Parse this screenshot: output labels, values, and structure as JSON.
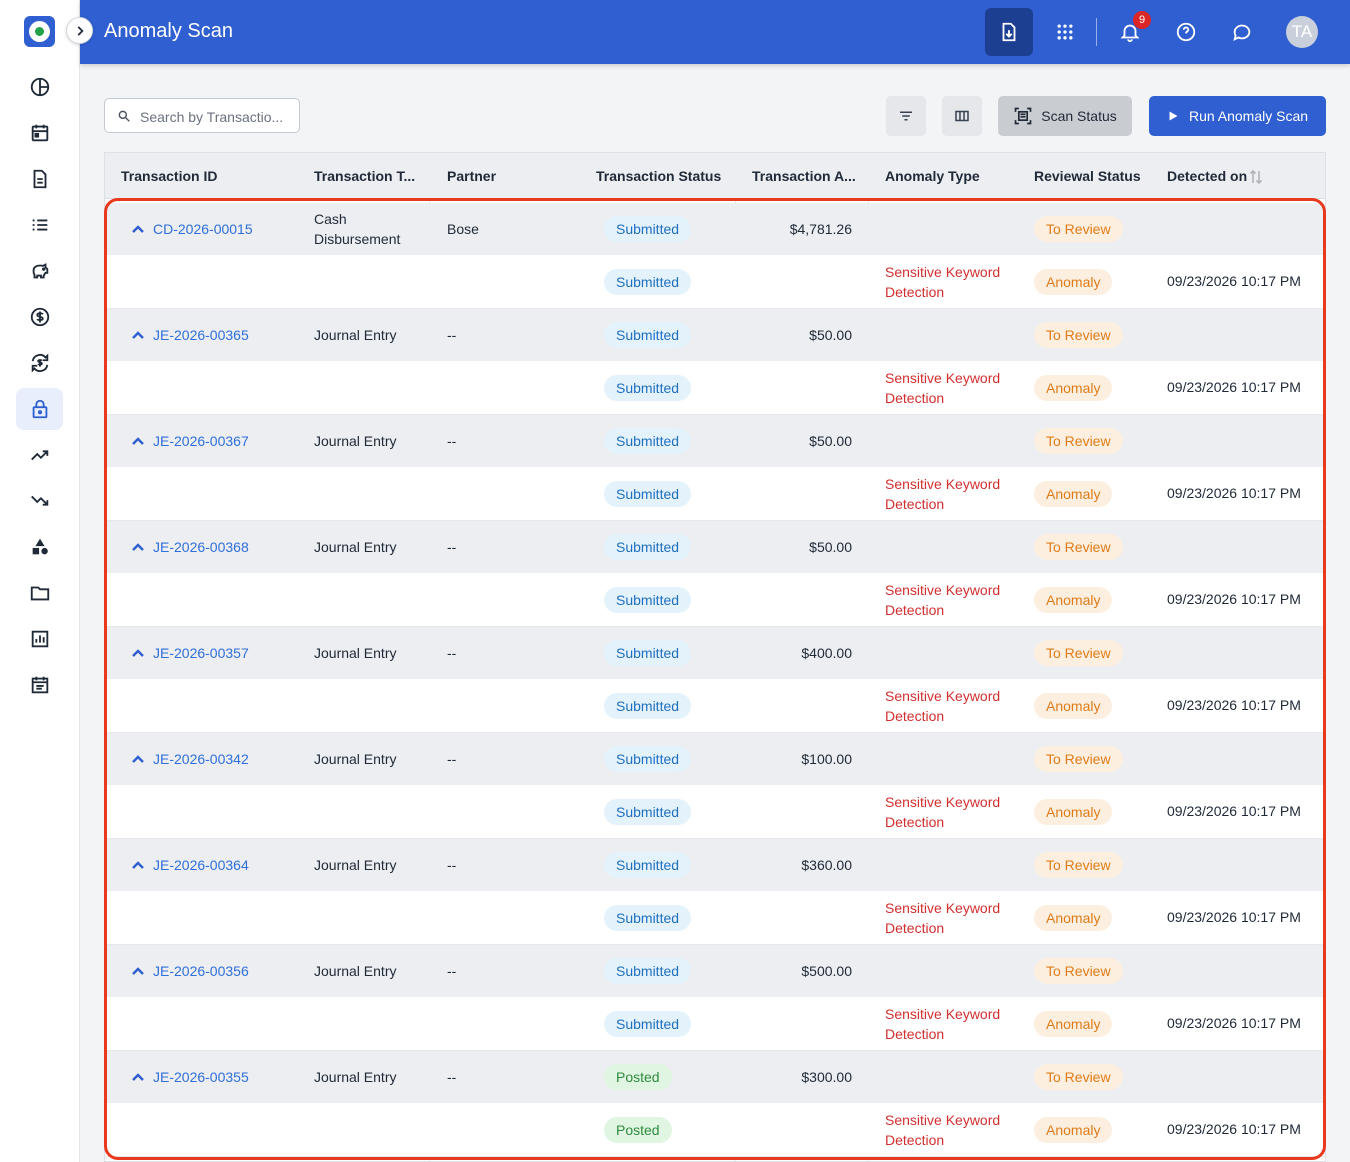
{
  "app": {
    "title": "Anomaly Scan"
  },
  "header": {
    "notification_count": "9",
    "avatar_initials": "TA"
  },
  "sidebar": {
    "items": [
      {
        "icon": "pie-chart-icon"
      },
      {
        "icon": "calendar-icon"
      },
      {
        "icon": "document-icon"
      },
      {
        "icon": "list-icon"
      },
      {
        "icon": "piggy-bank-icon"
      },
      {
        "icon": "dollar-circle-icon"
      },
      {
        "icon": "currency-exchange-icon"
      },
      {
        "icon": "lock-icon",
        "active": true
      },
      {
        "icon": "trending-up-icon"
      },
      {
        "icon": "trending-down-icon"
      },
      {
        "icon": "shapes-icon"
      },
      {
        "icon": "folder-icon"
      },
      {
        "icon": "bar-chart-icon"
      },
      {
        "icon": "event-note-icon"
      }
    ]
  },
  "toolbar": {
    "search_placeholder": "Search by Transactio...",
    "scan_status_label": "Scan Status",
    "run_label": "Run Anomaly Scan"
  },
  "table": {
    "headers": {
      "id": "Transaction ID",
      "type": "Transaction T...",
      "partner": "Partner",
      "status": "Transaction Status",
      "amount": "Transaction A...",
      "anomaly": "Anomaly Type",
      "review": "Reviewal Status",
      "detected": "Detected on"
    },
    "rows": [
      {
        "id": "CD-2026-00015",
        "type_line1": "Cash",
        "type_line2": "Disbursement",
        "partner": "Bose",
        "status": "Submitted",
        "amount": "$4,781.26",
        "review": "To Review",
        "child_status": "Submitted",
        "anomaly_line1": "Sensitive Keyword",
        "anomaly_line2": "Detection",
        "child_review": "Anomaly",
        "detected": "09/23/2026 10:17 PM"
      },
      {
        "id": "JE-2026-00365",
        "type_line1": "Journal Entry",
        "type_line2": "",
        "partner": "--",
        "status": "Submitted",
        "amount": "$50.00",
        "review": "To Review",
        "child_status": "Submitted",
        "anomaly_line1": "Sensitive Keyword",
        "anomaly_line2": "Detection",
        "child_review": "Anomaly",
        "detected": "09/23/2026 10:17 PM"
      },
      {
        "id": "JE-2026-00367",
        "type_line1": "Journal Entry",
        "type_line2": "",
        "partner": "--",
        "status": "Submitted",
        "amount": "$50.00",
        "review": "To Review",
        "child_status": "Submitted",
        "anomaly_line1": "Sensitive Keyword",
        "anomaly_line2": "Detection",
        "child_review": "Anomaly",
        "detected": "09/23/2026 10:17 PM"
      },
      {
        "id": "JE-2026-00368",
        "type_line1": "Journal Entry",
        "type_line2": "",
        "partner": "--",
        "status": "Submitted",
        "amount": "$50.00",
        "review": "To Review",
        "child_status": "Submitted",
        "anomaly_line1": "Sensitive Keyword",
        "anomaly_line2": "Detection",
        "child_review": "Anomaly",
        "detected": "09/23/2026 10:17 PM"
      },
      {
        "id": "JE-2026-00357",
        "type_line1": "Journal Entry",
        "type_line2": "",
        "partner": "--",
        "status": "Submitted",
        "amount": "$400.00",
        "review": "To Review",
        "child_status": "Submitted",
        "anomaly_line1": "Sensitive Keyword",
        "anomaly_line2": "Detection",
        "child_review": "Anomaly",
        "detected": "09/23/2026 10:17 PM"
      },
      {
        "id": "JE-2026-00342",
        "type_line1": "Journal Entry",
        "type_line2": "",
        "partner": "--",
        "status": "Submitted",
        "amount": "$100.00",
        "review": "To Review",
        "child_status": "Submitted",
        "anomaly_line1": "Sensitive Keyword",
        "anomaly_line2": "Detection",
        "child_review": "Anomaly",
        "detected": "09/23/2026 10:17 PM"
      },
      {
        "id": "JE-2026-00364",
        "type_line1": "Journal Entry",
        "type_line2": "",
        "partner": "--",
        "status": "Submitted",
        "amount": "$360.00",
        "review": "To Review",
        "child_status": "Submitted",
        "anomaly_line1": "Sensitive Keyword",
        "anomaly_line2": "Detection",
        "child_review": "Anomaly",
        "detected": "09/23/2026 10:17 PM"
      },
      {
        "id": "JE-2026-00356",
        "type_line1": "Journal Entry",
        "type_line2": "",
        "partner": "--",
        "status": "Submitted",
        "amount": "$500.00",
        "review": "To Review",
        "child_status": "Submitted",
        "anomaly_line1": "Sensitive Keyword",
        "anomaly_line2": "Detection",
        "child_review": "Anomaly",
        "detected": "09/23/2026 10:17 PM"
      },
      {
        "id": "JE-2026-00355",
        "type_line1": "Journal Entry",
        "type_line2": "",
        "partner": "--",
        "status": "Posted",
        "amount": "$300.00",
        "review": "To Review",
        "child_status": "Posted",
        "anomaly_line1": "Sensitive Keyword",
        "anomaly_line2": "Detection",
        "child_review": "Anomaly",
        "detected": "09/23/2026 10:17 PM"
      }
    ]
  },
  "colors": {
    "primary": "#2f5fd0",
    "submitted": "#1f6fc0",
    "posted": "#2e8b3d",
    "review": "#e07b17",
    "anomaly": "#d32f2f",
    "highlight_border": "#e8391f"
  }
}
